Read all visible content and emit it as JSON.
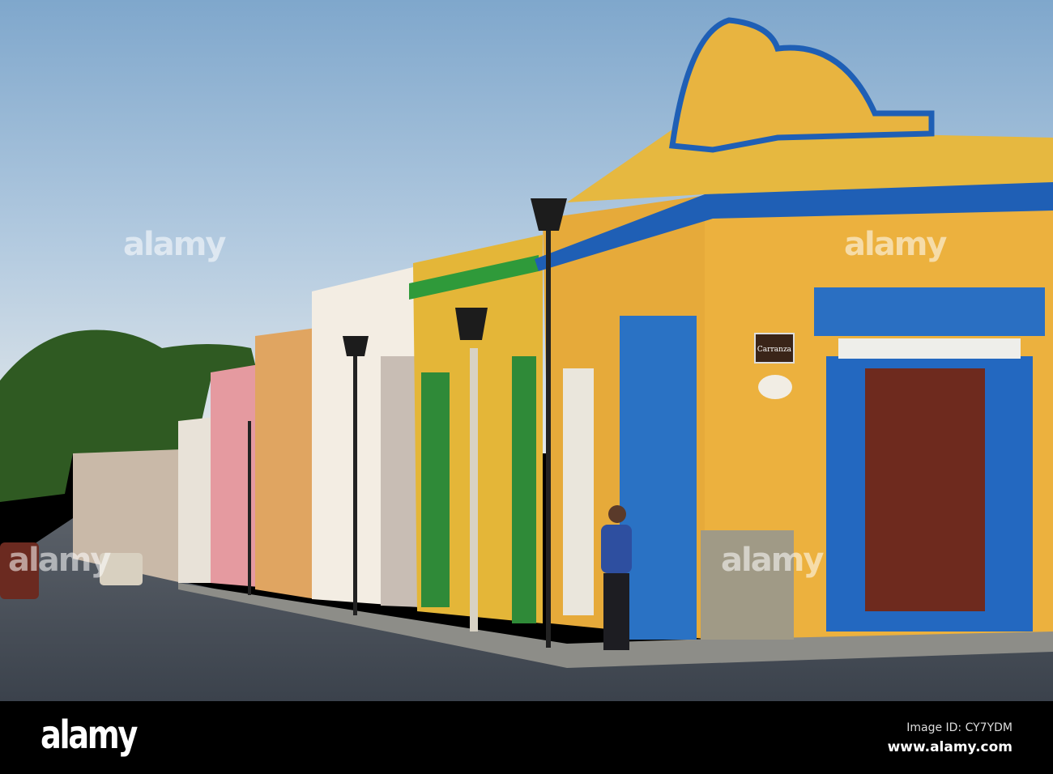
{
  "photo": {
    "street_sign": "Carranza",
    "watermarks": [
      "alamy",
      "alamy",
      "alamy",
      "alamy"
    ]
  },
  "footer": {
    "logo": "alamy",
    "image_id": "Image ID: CY7YDM",
    "url": "www.alamy.com"
  },
  "colors": {
    "sky_top": "#7fa7cc",
    "sky_bottom": "#dde5ea",
    "yellow_wall": "#e9b23e",
    "blue_trim": "#1f5fb5",
    "door": "#6e2a1e",
    "street": "#4d5560"
  }
}
